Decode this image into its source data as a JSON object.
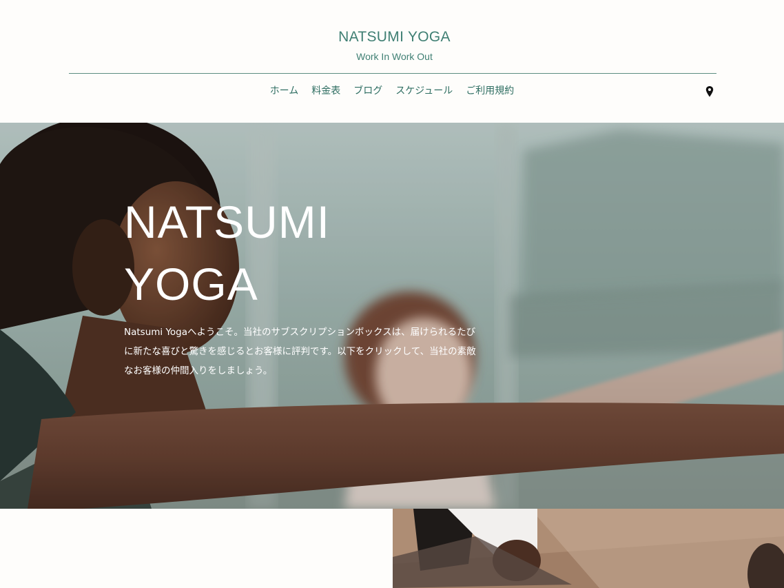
{
  "header": {
    "site_title": "NATSUMI YOGA",
    "tagline": "Work In Work Out"
  },
  "nav": {
    "items": [
      {
        "label": "ホーム"
      },
      {
        "label": "料金表"
      },
      {
        "label": "ブログ"
      },
      {
        "label": "スケジュール"
      },
      {
        "label": "ご利用規約"
      }
    ],
    "location_icon": "map-pin-icon"
  },
  "hero": {
    "title_line1": "NATSUMI",
    "title_line2": "YOGA",
    "description": "Natsumi Yogaへようこそ。当社のサブスクリプションボックスは、届けられるたびに新たな喜びと驚きを感じるとお客様に評判です。以下をクリックして、当社の素敵なお客様の仲間入りをしましょう。"
  },
  "colors": {
    "accent": "#3f7f73",
    "background": "#fefdfb",
    "hero_text": "#ffffff"
  }
}
